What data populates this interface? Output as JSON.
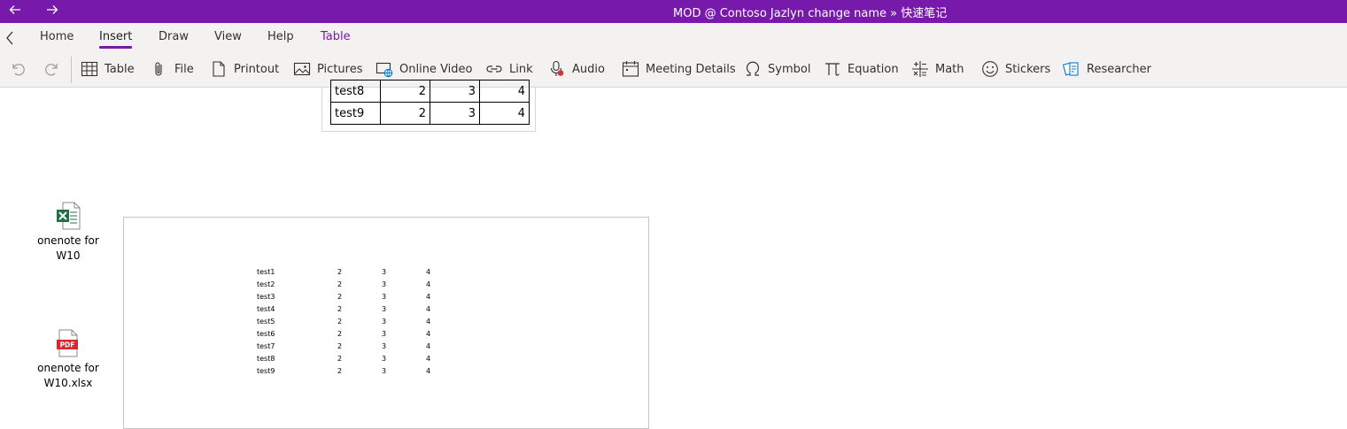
{
  "window": {
    "title": "MOD @ Contoso Jazlyn change name » 快速笔记"
  },
  "ribbon": {
    "tabs": [
      "Home",
      "Insert",
      "Draw",
      "View",
      "Help",
      "Table"
    ],
    "active_tab": "Insert",
    "contextual_tab": "Table",
    "toolbar": {
      "table": "Table",
      "file": "File",
      "printout": "Printout",
      "pictures": "Pictures",
      "online_video": "Online Video",
      "link": "Link",
      "audio": "Audio",
      "meeting_details": "Meeting Details",
      "symbol": "Symbol",
      "equation": "Equation",
      "math": "Math",
      "stickers": "Stickers",
      "researcher": "Researcher"
    }
  },
  "page": {
    "visible_table": {
      "partial_row": [
        "test8",
        "2",
        "3",
        "4"
      ],
      "row": [
        "test9",
        "2",
        "3",
        "4"
      ]
    },
    "attachments": [
      {
        "label_line1": "onenote for",
        "label_line2": "W10",
        "type": "excel"
      },
      {
        "label_line1": "onenote for",
        "label_line2": "W10.xlsx",
        "type": "pdf"
      }
    ],
    "printout_rows": [
      [
        "test1",
        "2",
        "3",
        "4"
      ],
      [
        "test2",
        "2",
        "3",
        "4"
      ],
      [
        "test3",
        "2",
        "3",
        "4"
      ],
      [
        "test4",
        "2",
        "3",
        "4"
      ],
      [
        "test5",
        "2",
        "3",
        "4"
      ],
      [
        "test6",
        "2",
        "3",
        "4"
      ],
      [
        "test7",
        "2",
        "3",
        "4"
      ],
      [
        "test8",
        "2",
        "3",
        "4"
      ],
      [
        "test9",
        "2",
        "3",
        "4"
      ]
    ]
  },
  "colors": {
    "brand": "#7719aa",
    "ribbon_bg": "#f3f2f1",
    "excel_green": "#1e7145",
    "pdf_red": "#d9282f"
  }
}
